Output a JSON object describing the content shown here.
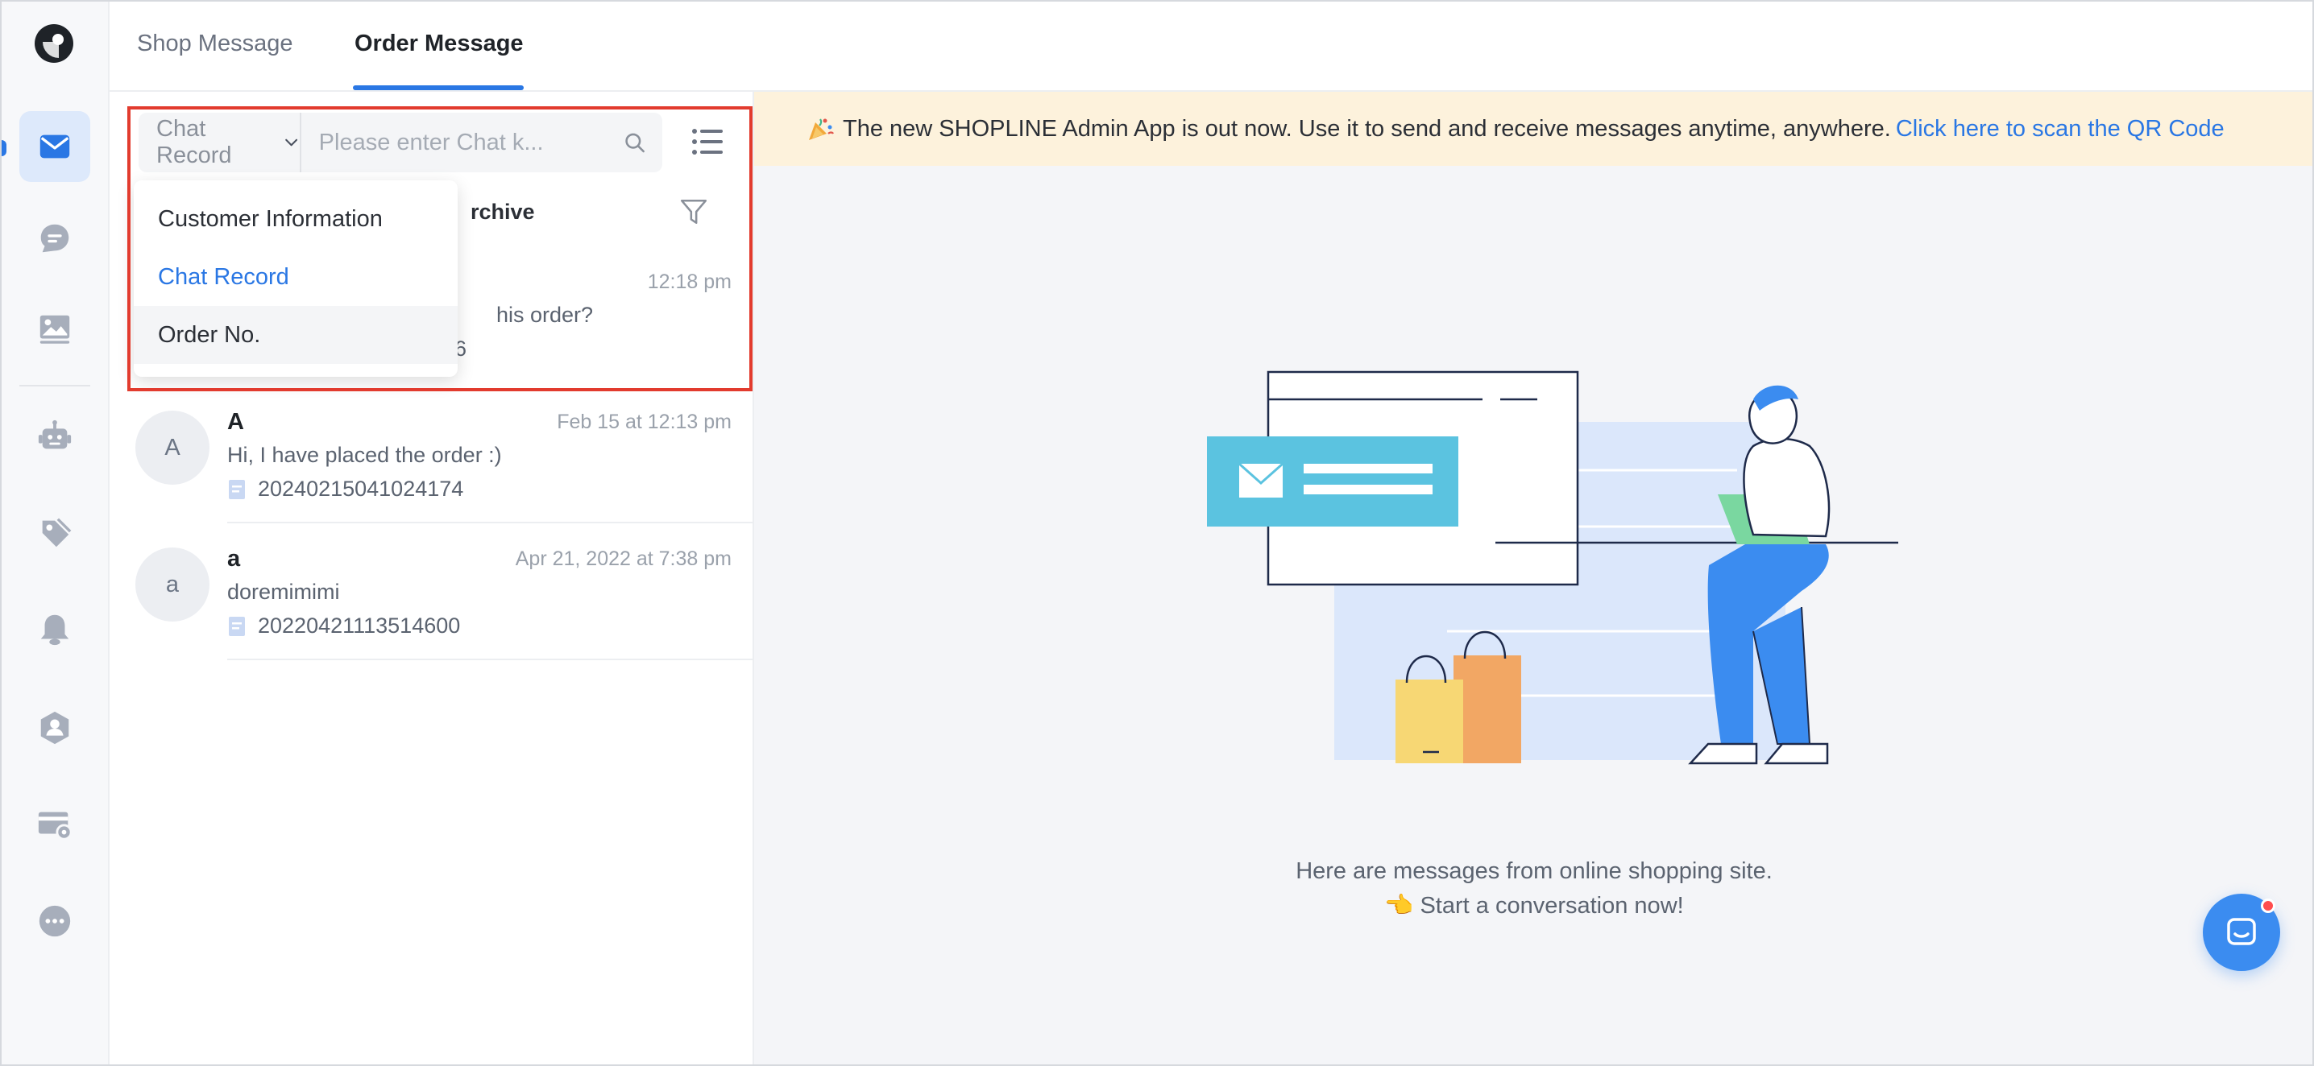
{
  "tabs": [
    {
      "label": "Shop Message",
      "active": false
    },
    {
      "label": "Order Message",
      "active": true
    }
  ],
  "search": {
    "type_selected": "Chat Record",
    "placeholder": "Please enter Chat k..."
  },
  "dropdown": {
    "options": [
      "Customer Information",
      "Chat Record",
      "Order No."
    ],
    "selected": "Chat Record",
    "hovered": "Order No."
  },
  "filter": {
    "archive_label": "rchive"
  },
  "conversations": [
    {
      "name": "",
      "time": "12:18 pm",
      "preview": "his order?",
      "order": "6",
      "avatar": ""
    },
    {
      "name": "A",
      "time": "Feb 15 at 12:13 pm",
      "preview": "Hi, I have placed the order :)",
      "order": "20240215041024174",
      "avatar": "A"
    },
    {
      "name": "a",
      "time": "Apr 21, 2022 at 7:38 pm",
      "preview": "doremimimi",
      "order": "20220421113514600",
      "avatar": "a"
    }
  ],
  "banner": {
    "text": "The new SHOPLINE Admin App is out now. Use it to send and receive messages anytime, anywhere.",
    "link": "Click here to scan the QR Code"
  },
  "empty_state": {
    "line1": "Here are messages from online shopping site.",
    "line2": "👈 Start a conversation now!"
  },
  "rail_icons": [
    "logo-icon",
    "message-icon",
    "chat-icon",
    "image-icon",
    "robot-icon",
    "tag-icon",
    "bell-icon",
    "user-shield-icon",
    "card-settings-icon",
    "more-icon"
  ],
  "colors": {
    "accent": "#2a77e4",
    "highlight_border": "#e23b2e",
    "banner_bg": "#fdf2dc"
  }
}
